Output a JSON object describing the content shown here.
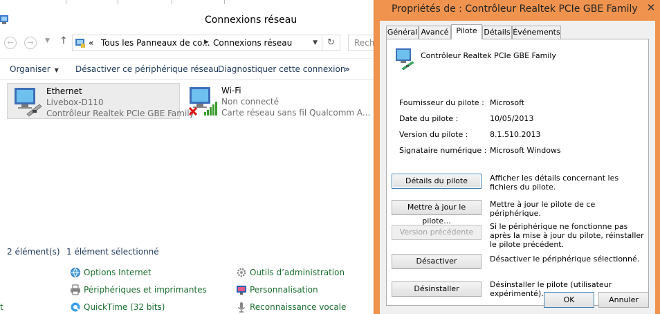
{
  "background_window": {
    "title": "Connexions réseau",
    "address": {
      "chevron": "«",
      "crumb1": "Tous les Panneaux de co...",
      "crumb2": "Connexions réseau"
    },
    "search_placeholder": "Reche",
    "commands": [
      {
        "label": "Organiser",
        "has_dropdown": true
      },
      {
        "label": "Désactiver ce périphérique réseau"
      },
      {
        "label": "Diagnostiquer cette connexion"
      },
      {
        "label": "»"
      }
    ],
    "connections": [
      {
        "name": "Ethernet",
        "line1": "Livebox-D110",
        "line2": "Contrôleur Realtek PCIe GBE Family",
        "selected": true
      },
      {
        "name": "Wi-Fi",
        "line1": "Non connecté",
        "line2": "Carte réseau sans fil Qualcomm A...",
        "selected": false
      }
    ],
    "status": {
      "count": "2 élément(s)",
      "selected": "1 élément sélectionné"
    },
    "control_panel_links": [
      {
        "label": "Options Internet",
        "icon": "globe-icon"
      },
      {
        "label": "Outils d’administration",
        "icon": "admin-tools-icon"
      },
      {
        "label": "Périphériques et imprimantes",
        "icon": "printer-icon"
      },
      {
        "label": "Personnalisation",
        "icon": "personalization-icon"
      },
      {
        "label": "QuickTime (32 bits)",
        "icon": "quicktime-icon"
      },
      {
        "label": "Reconnaissance vocale",
        "icon": "microphone-icon"
      },
      {
        "label": "t",
        "icon": ""
      }
    ]
  },
  "dialog": {
    "title": "Propriétés de : Contrôleur Realtek PCIe GBE Family",
    "close_glyph": "✕",
    "tabs": [
      "Général",
      "Avancé",
      "Pilote",
      "Détails",
      "Événements"
    ],
    "active_tab": "Pilote",
    "device_name": "Contrôleur Realtek PCIe GBE Family",
    "properties": [
      {
        "label": "Fournisseur du pilote :",
        "value": "Microsoft"
      },
      {
        "label": "Date du pilote :",
        "value": "10/05/2013"
      },
      {
        "label": "Version du pilote :",
        "value": "8.1.510.2013"
      },
      {
        "label": "Signataire numérique :",
        "value": "Microsoft Windows"
      }
    ],
    "actions": [
      {
        "button": "Détails du pilote",
        "description": "Afficher les détails concernant les fichiers du pilote.",
        "enabled": true,
        "focused": true
      },
      {
        "button": "Mettre à jour le pilote...",
        "description": "Mettre à jour le pilote de ce périphérique.",
        "enabled": true
      },
      {
        "button": "Version précédente",
        "description": "Si le périphérique ne fonctionne pas après la mise à jour du pilote, réinstaller le pilote précédent.",
        "enabled": false
      },
      {
        "button": "Désactiver",
        "description": "Désactiver le périphérique sélectionné.",
        "enabled": true
      },
      {
        "button": "Désinstaller",
        "description": "Désinstaller le pilote (utilisateur expérimenté).",
        "enabled": true
      }
    ],
    "ok_label": "OK",
    "cancel_label": "Annuler"
  },
  "colors": {
    "dialog_frame": "#f0934e",
    "link_green": "#1a6e2e",
    "command_blue": "#1e395b",
    "selection_gray": "#ececec"
  }
}
